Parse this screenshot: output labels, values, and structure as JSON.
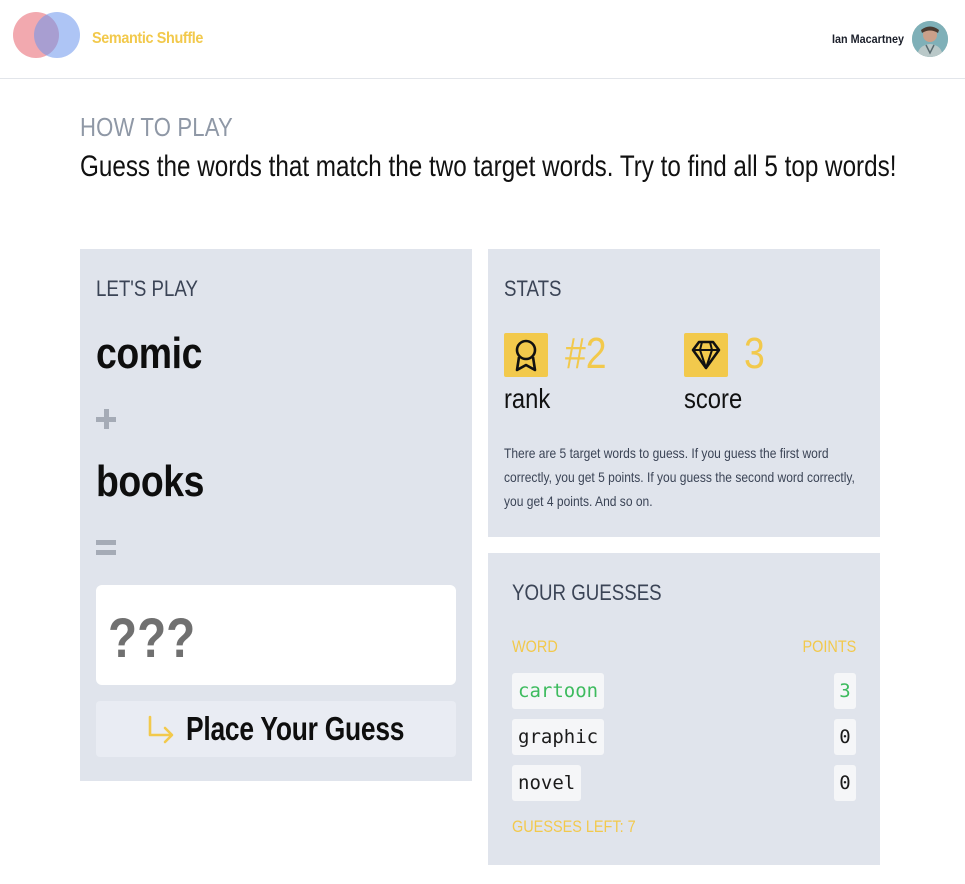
{
  "header": {
    "app_title": "Semantic Shuffle",
    "user_name": "Ian Macartney",
    "logo_icon": "venn-circles-icon",
    "avatar_icon": "user-avatar"
  },
  "how_to_play": {
    "label": "HOW TO PLAY",
    "text": "Guess the words that match the two target words. Try to find all 5 top words!"
  },
  "play": {
    "label": "LET'S PLAY",
    "word1": "comic",
    "word2": "books",
    "plus_icon": "plus-icon",
    "equals_icon": "equals-icon",
    "guess_placeholder": "???",
    "place_button_label": "Place Your Guess",
    "place_button_icon": "arrow-turn-right-icon"
  },
  "stats": {
    "label": "STATS",
    "rank_value": "#2",
    "rank_label": "rank",
    "rank_icon": "award-ribbon-icon",
    "score_value": "3",
    "score_label": "score",
    "score_icon": "diamond-icon",
    "description": "There are 5 target words to guess. If you guess the first word correctly, you get 5 points. If you guess the second word correctly, you get 4 points. And so on."
  },
  "guesses": {
    "label": "YOUR GUESSES",
    "col_word": "WORD",
    "col_points": "POINTS",
    "rows": [
      {
        "word": "cartoon",
        "points": "3"
      },
      {
        "word": "graphic",
        "points": "0"
      },
      {
        "word": "novel",
        "points": "0"
      }
    ],
    "guesses_left": "GUESSES LEFT: 7"
  },
  "colors": {
    "accent": "#f2c94c",
    "panel_bg": "#e0e4ec",
    "correct": "#3dbb5e",
    "muted": "#8f98a6"
  }
}
